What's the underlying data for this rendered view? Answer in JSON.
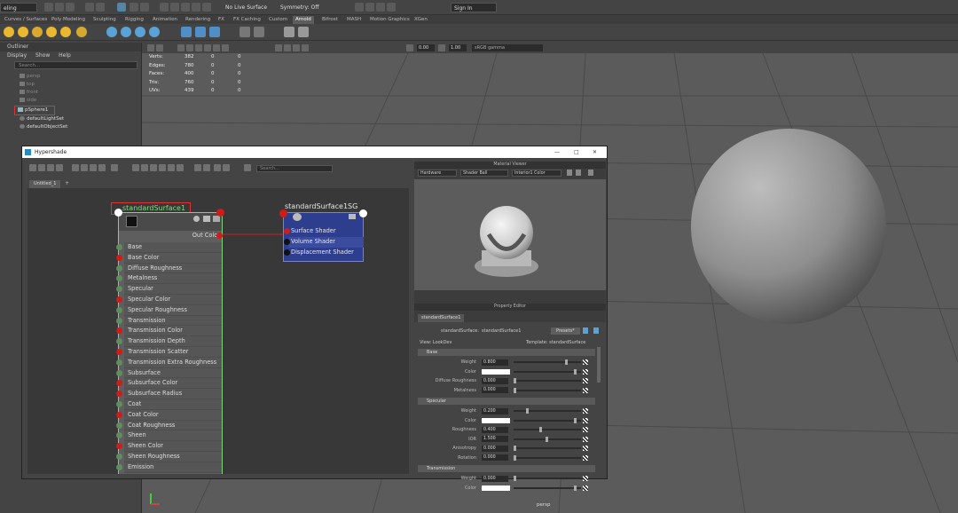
{
  "statusline": {
    "menuset": "eling",
    "live_surface": "No Live Surface",
    "symmetry": "Symmetry: Off",
    "sign_in": "Sign In"
  },
  "shelf_tabs": [
    "Curves / Surfaces",
    "Poly Modeling",
    "Sculpting",
    "Rigging",
    "Animation",
    "Rendering",
    "FX",
    "FX Caching",
    "Custom",
    "Arnold",
    "Bifrost",
    "MASH",
    "Motion Graphics",
    "XGen"
  ],
  "shelf_active_tab": "Arnold",
  "outliner": {
    "title": "Outliner",
    "menu": [
      "Display",
      "Show",
      "Help"
    ],
    "search_placeholder": "Search...",
    "items": [
      "persp",
      "top",
      "front",
      "side",
      "pSphere1",
      "defaultLightSet",
      "defaultObjectSet"
    ]
  },
  "viewport": {
    "hud": [
      {
        "label": "Verts:",
        "a": "382",
        "b": "0",
        "c": "0"
      },
      {
        "label": "Edges:",
        "a": "780",
        "b": "0",
        "c": "0"
      },
      {
        "label": "Faces:",
        "a": "400",
        "b": "0",
        "c": "0"
      },
      {
        "label": "Tris:",
        "a": "760",
        "b": "0",
        "c": "0"
      },
      {
        "label": "UVs:",
        "a": "439",
        "b": "0",
        "c": "0"
      }
    ],
    "exposure": "0.00",
    "gamma": "1.00",
    "color_space": "sRGB gamma",
    "camera": "persp"
  },
  "hypershade": {
    "title": "Hypershade",
    "search_placeholder": "Search...",
    "tab": "Untitled_1",
    "tab_add": "+",
    "shader_node": {
      "name": "standardSurface1",
      "output": "Out Color",
      "attributes": [
        {
          "label": "Base",
          "port": "green"
        },
        {
          "label": "Base Color",
          "port": "red"
        },
        {
          "label": "Diffuse Roughness",
          "port": "green"
        },
        {
          "label": "Metalness",
          "port": "green"
        },
        {
          "label": "Specular",
          "port": "green"
        },
        {
          "label": "Specular Color",
          "port": "red"
        },
        {
          "label": "Specular Roughness",
          "port": "green"
        },
        {
          "label": "Transmission",
          "port": "green"
        },
        {
          "label": "Transmission Color",
          "port": "red"
        },
        {
          "label": "Transmission Depth",
          "port": "green"
        },
        {
          "label": "Transmission Scatter",
          "port": "red"
        },
        {
          "label": "Transmission Extra Roughness",
          "port": "green"
        },
        {
          "label": "Subsurface",
          "port": "green"
        },
        {
          "label": "Subsurface Color",
          "port": "red"
        },
        {
          "label": "Subsurface Radius",
          "port": "red"
        },
        {
          "label": "Coat",
          "port": "green"
        },
        {
          "label": "Coat Color",
          "port": "red"
        },
        {
          "label": "Coat Roughness",
          "port": "green"
        },
        {
          "label": "Sheen",
          "port": "green"
        },
        {
          "label": "Sheen Color",
          "port": "red"
        },
        {
          "label": "Sheen Roughness",
          "port": "green"
        },
        {
          "label": "Emission",
          "port": "green"
        }
      ]
    },
    "sg_node": {
      "name": "standardSurface1SG",
      "slots": [
        "Surface Shader",
        "Volume Shader",
        "Displacement Shader"
      ]
    },
    "material_viewer": {
      "title": "Material Viewer",
      "renderer": "Hardware",
      "shape": "Shader Ball",
      "environment": "Interior1 Color"
    },
    "property_editor": {
      "title": "Property Editor",
      "tab": "standardSurface1",
      "type_label": "standardSurface:",
      "node_value": "standardSurface1",
      "presets": "Presets*",
      "view": "View: LookDev",
      "template": "Template: standardSurface",
      "sections": [
        {
          "name": "Base",
          "attrs": [
            {
              "label": "Weight",
              "value": "0.800",
              "type": "num",
              "level": 0.8
            },
            {
              "label": "Color",
              "value": "",
              "type": "color"
            },
            {
              "label": "Diffuse Roughness",
              "value": "0.000",
              "type": "num",
              "level": 0
            },
            {
              "label": "Metalness",
              "value": "0.000",
              "type": "num",
              "level": 0
            }
          ]
        },
        {
          "name": "Specular",
          "attrs": [
            {
              "label": "Weight",
              "value": "0.200",
              "type": "num",
              "level": 0.2
            },
            {
              "label": "Color",
              "value": "",
              "type": "color"
            },
            {
              "label": "Roughness",
              "value": "0.400",
              "type": "num",
              "level": 0.4
            },
            {
              "label": "IOR",
              "value": "1.500",
              "type": "num",
              "level": 0.5
            },
            {
              "label": "Anisotropy",
              "value": "0.000",
              "type": "num",
              "level": 0
            },
            {
              "label": "Rotation",
              "value": "0.000",
              "type": "num",
              "level": 0
            }
          ]
        },
        {
          "name": "Transmission",
          "attrs": [
            {
              "label": "Weight",
              "value": "0.000",
              "type": "num",
              "level": 0
            },
            {
              "label": "Color",
              "value": "",
              "type": "color"
            }
          ]
        }
      ]
    }
  },
  "colors": {
    "selection_red": "#d33",
    "node_green": "#7fdd7f",
    "sg_blue": "#2e3e8e"
  }
}
